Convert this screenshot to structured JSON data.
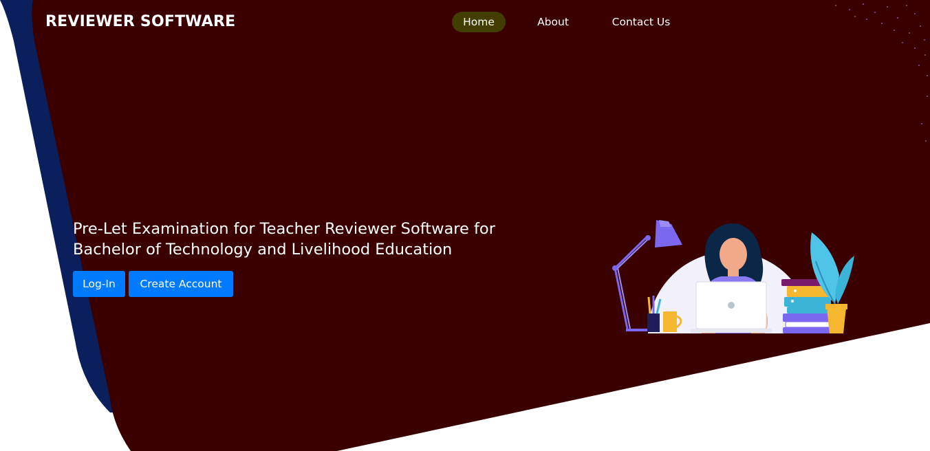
{
  "brand": {
    "name": "REVIEWER SOFTWARE"
  },
  "nav": {
    "items": [
      {
        "label": "Home",
        "active": true
      },
      {
        "label": "About",
        "active": false
      },
      {
        "label": "Contact Us",
        "active": false
      }
    ]
  },
  "hero": {
    "title_line1": "Pre-Let Examination for Teacher Reviewer Software for",
    "title_line2": "Bachelor of Technology and Livelihood Education",
    "login_label": "Log-In",
    "create_account_label": "Create Account"
  },
  "colors": {
    "hero_background": "#3a0000",
    "accent_shape": "#0a1f5c",
    "active_nav": "#433d00",
    "button": "#007bff",
    "page_background": "#ffffff"
  },
  "illustration": {
    "icon": "student-at-laptop-illustration"
  }
}
